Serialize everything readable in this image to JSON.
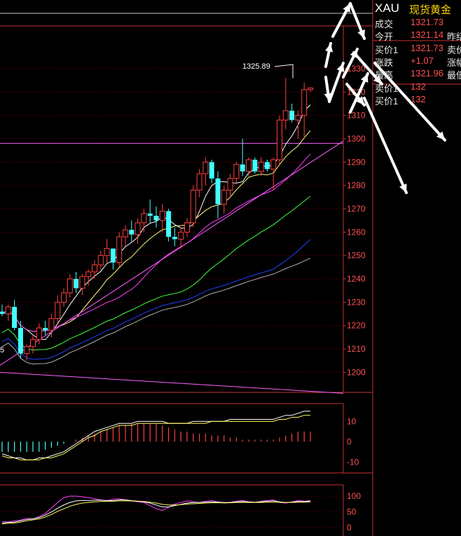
{
  "quote": {
    "symbol": "XAU",
    "name": "现货黄金",
    "rows": [
      {
        "label": "成交",
        "value": "1321.73",
        "label2": ""
      },
      {
        "label": "今开",
        "value": "1321.14",
        "label2": "昨结"
      },
      {
        "label": "买价1",
        "value": "1321.73",
        "label2": "卖价"
      },
      {
        "label": "涨跌",
        "value": "+1.07",
        "label2": "涨幅"
      },
      {
        "label": "最高",
        "value": "1321.96",
        "label2": "最低"
      },
      {
        "label": "卖价1",
        "value": "132",
        "label2": ""
      },
      {
        "label": "买价1",
        "value": "132",
        "label2": ""
      }
    ]
  },
  "annotations": {
    "high_label": "1325.89",
    "low_label": "5"
  },
  "colors": {
    "up": "#ff4040",
    "down": "#40ffff",
    "grid": "#7a0000",
    "axis": "#c83232",
    "ma5": "#ffffff",
    "ma10": "#ffff80",
    "ma20": "#ff40ff",
    "ma40": "#40ff40",
    "ma60": "#2040ff",
    "ma120": "#b0b0b0"
  },
  "chart_data": [
    {
      "type": "candlestick",
      "y_ticks": [
        1200,
        1210,
        1220,
        1230,
        1240,
        1250,
        1260,
        1270,
        1280,
        1290,
        1300,
        1310,
        1320,
        1330
      ],
      "ylim": [
        1195,
        1345
      ],
      "candles": [
        [
          1226,
          1229,
          1224,
          1225
        ],
        [
          1225,
          1229,
          1222,
          1228
        ],
        [
          1228,
          1231,
          1218,
          1219
        ],
        [
          1219,
          1222,
          1206,
          1208
        ],
        [
          1208,
          1212,
          1205,
          1211
        ],
        [
          1211,
          1216,
          1208,
          1214
        ],
        [
          1214,
          1221,
          1212,
          1219
        ],
        [
          1219,
          1222,
          1216,
          1218
        ],
        [
          1218,
          1225,
          1215,
          1223
        ],
        [
          1223,
          1233,
          1221,
          1230
        ],
        [
          1230,
          1236,
          1228,
          1234
        ],
        [
          1234,
          1242,
          1232,
          1240
        ],
        [
          1240,
          1243,
          1234,
          1236
        ],
        [
          1236,
          1242,
          1233,
          1241
        ],
        [
          1241,
          1244,
          1237,
          1243
        ],
        [
          1243,
          1248,
          1240,
          1246
        ],
        [
          1246,
          1252,
          1244,
          1250
        ],
        [
          1250,
          1257,
          1247,
          1253
        ],
        [
          1253,
          1252,
          1244,
          1247
        ],
        [
          1247,
          1260,
          1245,
          1258
        ],
        [
          1258,
          1263,
          1254,
          1261
        ],
        [
          1261,
          1265,
          1256,
          1259
        ],
        [
          1259,
          1266,
          1255,
          1264
        ],
        [
          1264,
          1270,
          1260,
          1268
        ],
        [
          1268,
          1274,
          1264,
          1267
        ],
        [
          1267,
          1271,
          1262,
          1265
        ],
        [
          1265,
          1272,
          1260,
          1269
        ],
        [
          1269,
          1270,
          1256,
          1258
        ],
        [
          1258,
          1262,
          1254,
          1257
        ],
        [
          1257,
          1262,
          1253,
          1260
        ],
        [
          1260,
          1266,
          1258,
          1264
        ],
        [
          1264,
          1280,
          1262,
          1278
        ],
        [
          1278,
          1287,
          1275,
          1285
        ],
        [
          1285,
          1292,
          1280,
          1290
        ],
        [
          1290,
          1291,
          1281,
          1283
        ],
        [
          1283,
          1286,
          1266,
          1272
        ],
        [
          1272,
          1280,
          1268,
          1278
        ],
        [
          1278,
          1285,
          1275,
          1283
        ],
        [
          1283,
          1290,
          1281,
          1289
        ],
        [
          1289,
          1300,
          1284,
          1286
        ],
        [
          1286,
          1292,
          1284,
          1291
        ],
        [
          1291,
          1292,
          1285,
          1286
        ],
        [
          1286,
          1292,
          1284,
          1290
        ],
        [
          1290,
          1291,
          1286,
          1287
        ],
        [
          1287,
          1292,
          1278,
          1291
        ],
        [
          1291,
          1310,
          1289,
          1308
        ],
        [
          1308,
          1326,
          1304,
          1312
        ],
        [
          1312,
          1315,
          1307,
          1308
        ],
        [
          1308,
          1312,
          1300,
          1310
        ],
        [
          1310,
          1324,
          1301,
          1321
        ],
        [
          1321,
          1322,
          1320,
          1321.7
        ]
      ],
      "hlines": [
        1298,
        1200
      ]
    },
    {
      "type": "line",
      "y_ticks": [
        10,
        0,
        -10
      ],
      "ylim": [
        -13,
        16
      ],
      "bars": [
        -5,
        -5,
        -5,
        -5,
        -5,
        -5,
        -5,
        -4,
        -3,
        -2,
        -1,
        0,
        1,
        2,
        3,
        4,
        5,
        6,
        7,
        8,
        8,
        9,
        9,
        9,
        9,
        9,
        8,
        7,
        6,
        5,
        5,
        4,
        4,
        4,
        3,
        3,
        3,
        2,
        2,
        1,
        1,
        1,
        1,
        1,
        1,
        2,
        3,
        4,
        5,
        5,
        5
      ],
      "series": [
        {
          "values": [
            -6,
            -7,
            -8,
            -8,
            -9,
            -9,
            -8,
            -8,
            -7,
            -6,
            -5,
            -3,
            -1,
            1,
            3,
            5,
            6,
            7,
            8,
            9,
            9,
            9,
            10,
            10,
            10,
            10,
            10,
            9,
            9,
            9,
            9,
            10,
            10,
            10,
            10,
            10,
            10,
            11,
            11,
            11,
            11,
            11,
            11,
            11,
            11,
            12,
            13,
            13,
            14,
            15,
            15
          ]
        },
        {
          "values": [
            -7,
            -8,
            -8,
            -9,
            -9,
            -9,
            -9,
            -8,
            -8,
            -7,
            -6,
            -4,
            -2,
            0,
            2,
            3,
            5,
            6,
            7,
            8,
            8,
            8,
            9,
            9,
            9,
            9,
            9,
            9,
            9,
            9,
            9,
            9,
            9,
            9,
            10,
            10,
            10,
            10,
            10,
            10,
            10,
            10,
            10,
            10,
            10,
            11,
            11,
            12,
            12,
            13,
            13
          ]
        }
      ]
    },
    {
      "type": "line",
      "y_ticks": [
        100,
        50,
        0
      ],
      "ylim": [
        -15,
        118
      ],
      "series": [
        {
          "values": [
            20,
            18,
            22,
            24,
            30,
            28,
            35,
            45,
            62,
            80,
            95,
            100,
            100,
            98,
            95,
            92,
            88,
            86,
            90,
            92,
            88,
            85,
            82,
            80,
            70,
            60,
            55,
            65,
            75,
            80,
            85,
            82,
            80,
            84,
            86,
            82,
            78,
            80,
            84,
            86,
            82,
            80,
            84,
            86,
            88,
            80,
            78,
            82,
            86,
            84,
            86
          ]
        },
        {
          "values": [
            15,
            17,
            18,
            22,
            26,
            28,
            32,
            40,
            50,
            62,
            72,
            80,
            85,
            86,
            86,
            87,
            87,
            86,
            86,
            88,
            88,
            86,
            84,
            82,
            78,
            72,
            66,
            66,
            70,
            74,
            78,
            80,
            80,
            81,
            82,
            81,
            80,
            80,
            82,
            83,
            82,
            81,
            82,
            84,
            85,
            82,
            80,
            81,
            83,
            83,
            84
          ]
        },
        {
          "values": [
            12,
            14,
            15,
            18,
            22,
            25,
            28,
            34,
            42,
            52,
            60,
            68,
            74,
            78,
            80,
            82,
            83,
            84,
            84,
            85,
            85,
            85,
            84,
            83,
            81,
            78,
            74,
            72,
            72,
            73,
            75,
            76,
            77,
            78,
            79,
            79,
            79,
            79,
            80,
            80,
            80,
            80,
            80,
            81,
            81,
            81,
            80,
            80,
            81,
            81,
            82
          ]
        }
      ]
    }
  ]
}
